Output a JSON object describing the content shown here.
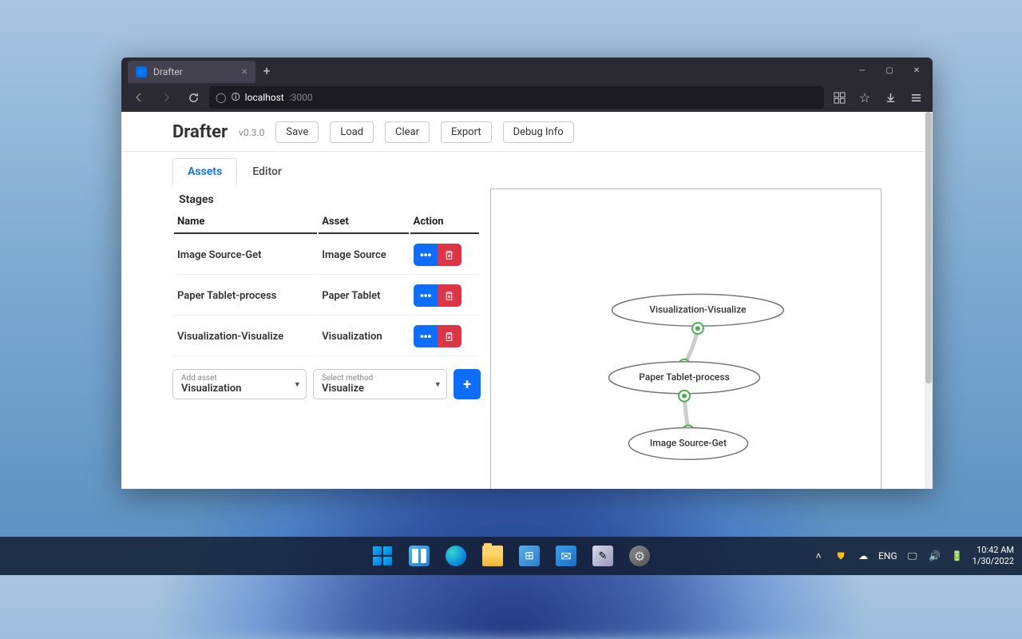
{
  "browser": {
    "tab_title": "Drafter",
    "url_host": "localhost",
    "url_port": ":3000"
  },
  "app": {
    "title": "Drafter",
    "version": "v0.3.0",
    "buttons": {
      "save": "Save",
      "load": "Load",
      "clear": "Clear",
      "export": "Export",
      "debug": "Debug Info"
    },
    "tabs": {
      "assets": "Assets",
      "editor": "Editor"
    }
  },
  "stages": {
    "title": "Stages",
    "columns": {
      "name": "Name",
      "asset": "Asset",
      "action": "Action"
    },
    "rows": [
      {
        "name": "Image Source-Get",
        "asset": "Image Source"
      },
      {
        "name": "Paper Tablet-process",
        "asset": "Paper Tablet"
      },
      {
        "name": "Visualization-Visualize",
        "asset": "Visualization"
      }
    ],
    "add_asset": {
      "label": "Add asset",
      "value": "Visualization"
    },
    "select_method": {
      "label": "Select method",
      "value": "Visualize"
    }
  },
  "graph": {
    "nodes": {
      "top": "Visualization-Visualize",
      "mid": "Paper Tablet-process",
      "bot": "Image Source-Get"
    }
  },
  "system": {
    "lang": "ENG",
    "time": "10:42 AM",
    "date": "1/30/2022"
  }
}
